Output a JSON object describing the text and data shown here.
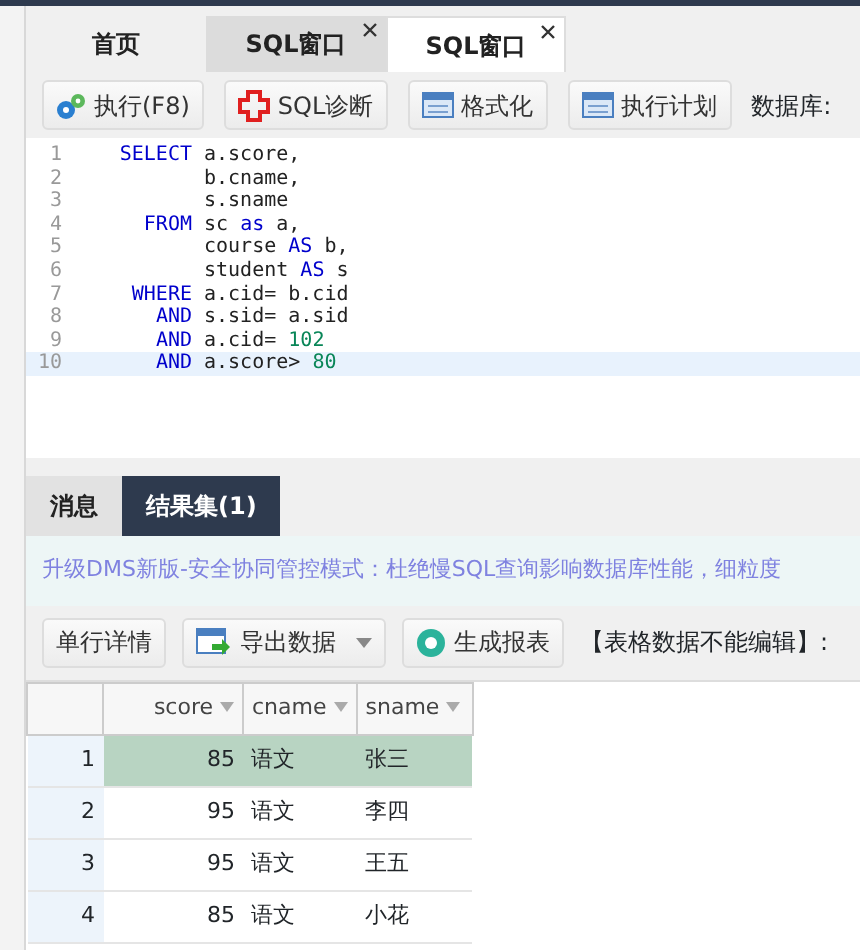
{
  "tabs": [
    {
      "label": "首页",
      "selected": false,
      "closable": false
    },
    {
      "label": "SQL窗口",
      "selected": false,
      "closable": true
    },
    {
      "label": "SQL窗口",
      "selected": true,
      "closable": true
    }
  ],
  "toolbar": {
    "buttons": [
      {
        "kind": "run",
        "label": "执行(F8)"
      },
      {
        "kind": "diagnose",
        "label": "SQL诊断"
      },
      {
        "kind": "table",
        "label": "格式化"
      },
      {
        "kind": "table",
        "label": "执行计划"
      }
    ],
    "database_label": "数据库:"
  },
  "editor": {
    "lines": [
      {
        "number": "1",
        "keyword": "SELECT",
        "tokens": [
          {
            "kind": "text",
            "text": "a.score,"
          }
        ],
        "current": false
      },
      {
        "number": "2",
        "tokens": [
          {
            "kind": "text",
            "text": "b.cname,"
          }
        ],
        "current": false
      },
      {
        "number": "3",
        "tokens": [
          {
            "kind": "text",
            "text": "s.sname"
          }
        ],
        "current": false
      },
      {
        "number": "4",
        "keyword": "FROM",
        "tokens": [
          {
            "kind": "text",
            "text": "sc "
          },
          {
            "kind": "keyword",
            "text": "as"
          },
          {
            "kind": "text",
            "text": " a,"
          }
        ],
        "current": false
      },
      {
        "number": "5",
        "tokens": [
          {
            "kind": "text",
            "text": "course "
          },
          {
            "kind": "keyword",
            "text": "AS"
          },
          {
            "kind": "text",
            "text": " b,"
          }
        ],
        "current": false
      },
      {
        "number": "6",
        "tokens": [
          {
            "kind": "text",
            "text": "student "
          },
          {
            "kind": "keyword",
            "text": "AS"
          },
          {
            "kind": "text",
            "text": " s"
          }
        ],
        "current": false
      },
      {
        "number": "7",
        "keyword": "WHERE",
        "tokens": [
          {
            "kind": "text",
            "text": "a.cid= b.cid"
          }
        ],
        "current": false
      },
      {
        "number": "8",
        "keyword": "AND",
        "tokens": [
          {
            "kind": "text",
            "text": "s.sid= a.sid"
          }
        ],
        "current": false
      },
      {
        "number": "9",
        "keyword": "AND",
        "tokens": [
          {
            "kind": "text",
            "text": "a.cid= "
          },
          {
            "kind": "number",
            "text": "102"
          }
        ],
        "current": false
      },
      {
        "number": "10",
        "keyword": "AND",
        "tokens": [
          {
            "kind": "text",
            "text": "a.score> "
          },
          {
            "kind": "number",
            "text": "80"
          }
        ],
        "current": true
      }
    ]
  },
  "result_tabs": [
    {
      "label": "消息",
      "selected": false
    },
    {
      "label": "结果集(1)",
      "selected": true
    }
  ],
  "notice": "升级DMS新版-安全协同管控模式：杜绝慢SQL查询影响数据库性能，细粒度",
  "result_toolbar": {
    "buttons": [
      {
        "kind": "plain",
        "label": "单行详情"
      },
      {
        "kind": "export",
        "label": "导出数据",
        "dropdown": true
      },
      {
        "kind": "report",
        "label": "生成报表"
      }
    ],
    "note": "【表格数据不能编辑】:"
  },
  "table": {
    "columns": [
      "score",
      "cname",
      "sname"
    ],
    "rows": [
      {
        "number": "1",
        "cells": [
          "85",
          "语文",
          "张三"
        ],
        "selected": true
      },
      {
        "number": "2",
        "cells": [
          "95",
          "语文",
          "李四"
        ],
        "selected": false
      },
      {
        "number": "3",
        "cells": [
          "95",
          "语文",
          "王五"
        ],
        "selected": false
      },
      {
        "number": "4",
        "cells": [
          "85",
          "语文",
          "小花"
        ],
        "selected": false
      }
    ]
  }
}
